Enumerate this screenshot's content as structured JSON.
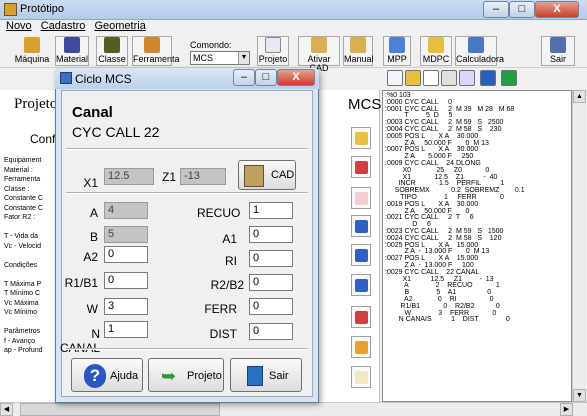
{
  "window": {
    "title": "Protótipo",
    "min": "‒",
    "max": "□",
    "close": "X"
  },
  "menu": [
    "Novo",
    "Cadastro",
    "Geometria"
  ],
  "toolbar": {
    "buttons": [
      {
        "label": "Máquina",
        "name": "maquina-button",
        "color": "#d8a030"
      },
      {
        "label": "Material",
        "name": "material-button",
        "color": "#404a9c"
      },
      {
        "label": "Classe",
        "name": "classe-button",
        "color": "#506020"
      },
      {
        "label": "Ferramenta",
        "name": "ferramenta-button",
        "color": "#d08830"
      },
      {
        "label": "Projeto",
        "name": "projeto-button",
        "color": "#e8e8f0"
      },
      {
        "label": "Ativar CAD",
        "name": "ativar-cad-button",
        "color": "#d8b050"
      },
      {
        "label": "Manual",
        "name": "manual-button",
        "color": "#d8b050"
      },
      {
        "label": "MPP",
        "name": "mpp-button",
        "color": "#5080d0"
      },
      {
        "label": "MDPC",
        "name": "mdpc-button",
        "color": "#e8c040"
      },
      {
        "label": "Calculadora",
        "name": "calculadora-button",
        "color": "#4878c0"
      },
      {
        "label": "Sair",
        "name": "sair-toolbar-button",
        "color": "#5070b0"
      }
    ],
    "comando_label": "Comondo:",
    "comando_value": "MCS"
  },
  "background": {
    "projeto": "Projeto",
    "configuracao": "Configu",
    "lines": [
      "Equipament",
      "Material :",
      "Ferramenta",
      "Classe :",
      "Constante C",
      "Constante C",
      "Fator R2 :",
      "",
      "T - Vida da",
      "Vc - Velocid",
      "",
      "Condições ",
      "",
      "T Máxima P",
      "T Mínimo C",
      "Vc Máxima",
      "Vc Mínimo",
      "",
      "Parâmetros",
      "f - Avanço",
      "ap - Profund"
    ],
    "mcs": "MCS"
  },
  "code_lines": [
    ":%0 103",
    ":0000 CYC CALL     0",
    ":0001 CYC CALL     2  M 39   M 28   M 68",
    "          T         5  D     5",
    ":0003 CYC CALL     2  M 59   S   2500",
    ":0004 CYC CALL     2  M 58   S    230",
    ":0005 POS L       X A    30.000",
    "          Z A     50.000 F       0  M 13",
    ":0007 POS L       X A    30.000",
    "          Z A       5.000 F     250",
    ":0009 CYC CALL    24 DLONG",
    "         X0             25     Z0            0",
    "         X1            12.5    Z1          -  40",
    "       INCR            1.5    PERFIL          1",
    "     SOBREMX           0.2  SOBREMZ        0.1",
    "        TIPO              1     FERR            0",
    ":0019 POS L       X A    30.000",
    "          Z A     50.000 F       0",
    ":0021 CYC CALL     2  T     6",
    "              D     6",
    ":0023 CYC CALL     2  M 59   S   1500",
    ":0024 CYC CALL     2  M 58   S    120",
    ":0025 POS L       X A    15.000",
    "          Z A  -  13.000 F       0  M 13",
    ":0027 POS L       X A    15.000",
    "          Z A  -  13.000 F     100",
    ":0029 CYC CALL    22 CANAL",
    "         X1          12.5     Z1         -  13",
    "          A              2    RECUO            1",
    "          B              5    A1                0",
    "          A2             0    RI                 0",
    "        R1/B1            0    R2/B2           0",
    "          W              3    FERR            0",
    "       N CANAIS          1    DIST              0"
  ],
  "dialog": {
    "title": "Ciclo MCS",
    "min": "‒",
    "max": "□",
    "close": "X",
    "heading": "Canal",
    "subheading": "CYC CALL 22",
    "fields": {
      "x1": {
        "label": "X1",
        "value": "12.5"
      },
      "z1": {
        "label": "Z1",
        "value": "-13"
      },
      "a": {
        "label": "A",
        "value": "4"
      },
      "recuo": {
        "label": "RECUO",
        "value": "1"
      },
      "b": {
        "label": "B",
        "value": "5"
      },
      "a1": {
        "label": "A1",
        "value": "0"
      },
      "a2": {
        "label": "A2",
        "value": "0"
      },
      "ri": {
        "label": "RI",
        "value": "0"
      },
      "r1b1": {
        "label": "R1/B1",
        "value": "0"
      },
      "r2b2": {
        "label": "R2/B2",
        "value": "0"
      },
      "w": {
        "label": "W",
        "value": "3"
      },
      "ferr": {
        "label": "FERR",
        "value": "0"
      },
      "ncanal": {
        "label": "N CANAL",
        "value": "1"
      },
      "dist": {
        "label": "DIST",
        "value": "0"
      }
    },
    "cad_button": "CAD",
    "ajuda_button": "Ajuda",
    "projeto_button": "Projeto",
    "sair_button": "Sair"
  }
}
